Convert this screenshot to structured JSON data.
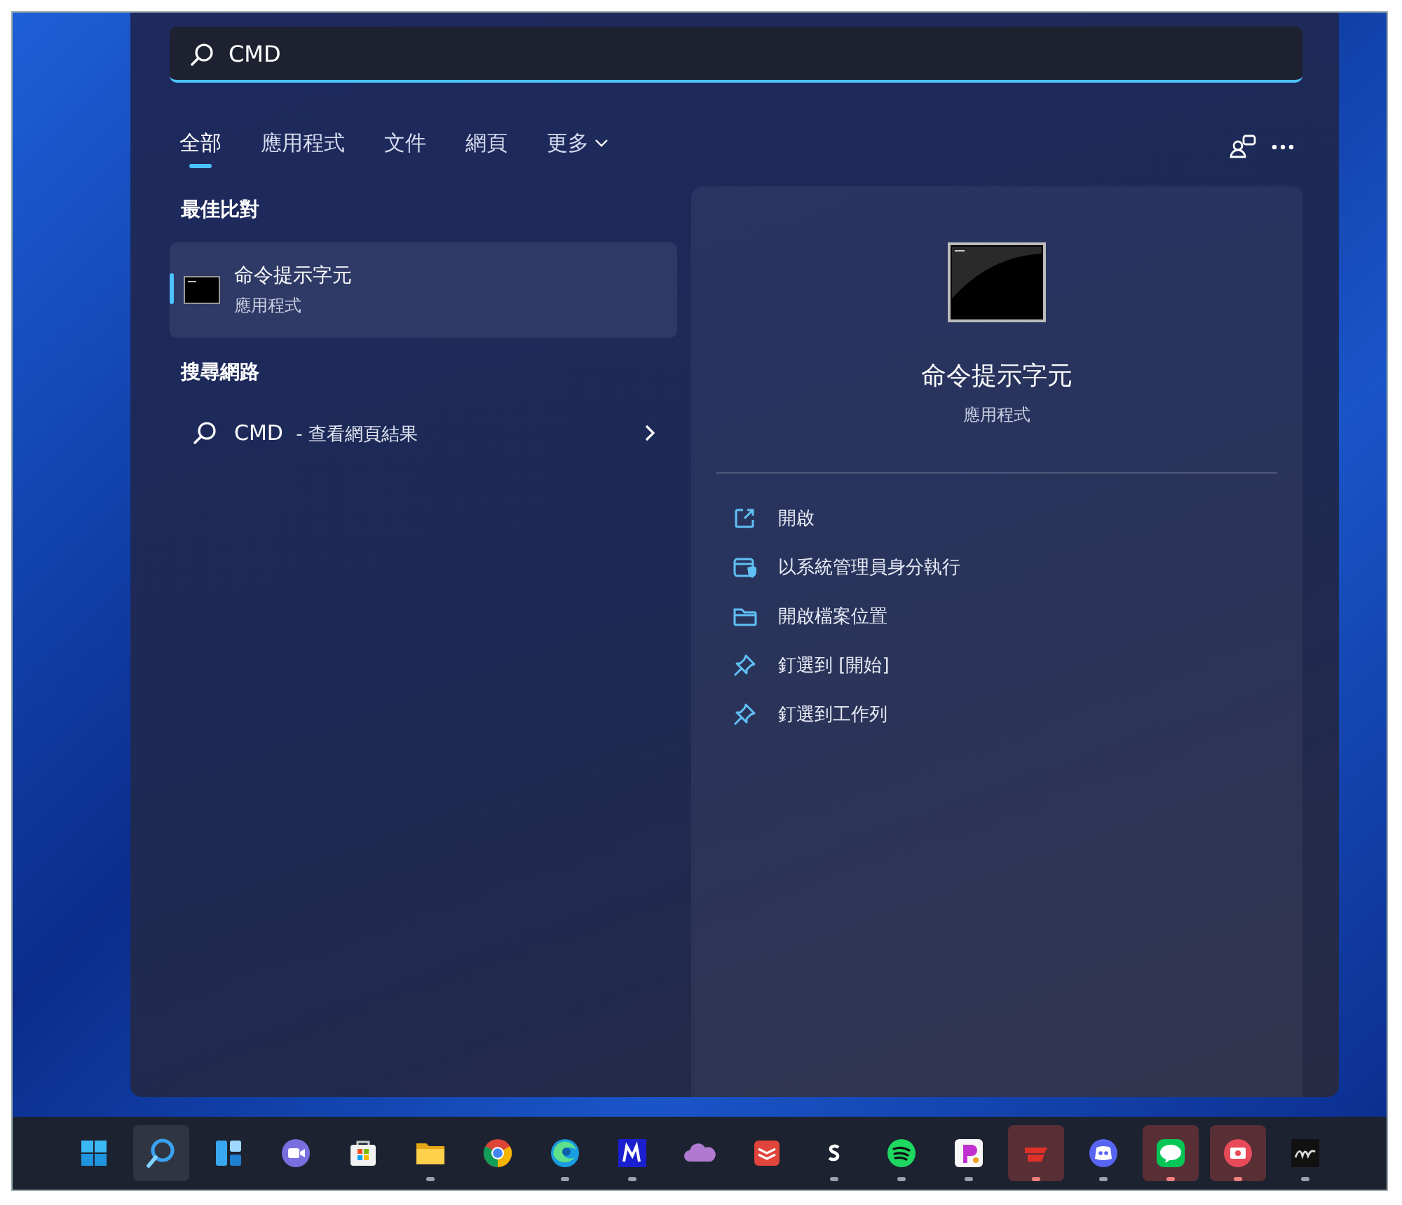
{
  "search": {
    "value": "CMD"
  },
  "tabs": [
    {
      "label": "全部",
      "selected": true,
      "kind": "plain"
    },
    {
      "label": "應用程式",
      "selected": false,
      "kind": "plain"
    },
    {
      "label": "文件",
      "selected": false,
      "kind": "plain"
    },
    {
      "label": "網頁",
      "selected": false,
      "kind": "plain"
    },
    {
      "label": "更多",
      "selected": false,
      "kind": "menu"
    }
  ],
  "best_match": {
    "heading": "最佳比對",
    "item": {
      "title": "命令提示字元",
      "subtitle": "應用程式",
      "selected": true
    }
  },
  "web_search": {
    "heading": "搜尋網路",
    "item": {
      "query": "CMD",
      "suffix": "- 查看網頁結果"
    }
  },
  "preview": {
    "title": "命令提示字元",
    "subtitle": "應用程式",
    "actions": [
      {
        "kind": "open",
        "label": "開啟"
      },
      {
        "kind": "admin",
        "label": "以系統管理員身分執行"
      },
      {
        "kind": "folder",
        "label": "開啟檔案位置"
      },
      {
        "kind": "pin",
        "label": "釘選到 [開始]"
      },
      {
        "kind": "pin",
        "label": "釘選到工作列"
      }
    ]
  },
  "taskbar": {
    "apps": [
      {
        "kind": "start",
        "selected": false,
        "running": false,
        "attention": false
      },
      {
        "kind": "search",
        "selected": true,
        "running": false,
        "attention": false
      },
      {
        "kind": "widgets",
        "selected": false,
        "running": false,
        "attention": false
      },
      {
        "kind": "chat",
        "selected": false,
        "running": false,
        "attention": false
      },
      {
        "kind": "store",
        "selected": false,
        "running": false,
        "attention": false
      },
      {
        "kind": "explorer",
        "selected": false,
        "running": true,
        "attention": false
      },
      {
        "kind": "chrome",
        "selected": false,
        "running": false,
        "attention": false
      },
      {
        "kind": "edge",
        "selected": false,
        "running": true,
        "attention": false
      },
      {
        "kind": "m",
        "selected": false,
        "running": true,
        "attention": false
      },
      {
        "kind": "cloud",
        "selected": false,
        "running": false,
        "attention": false
      },
      {
        "kind": "todo",
        "selected": false,
        "running": false,
        "attention": false
      },
      {
        "kind": "s",
        "selected": false,
        "running": true,
        "attention": false
      },
      {
        "kind": "spotify",
        "selected": false,
        "running": true,
        "attention": false
      },
      {
        "kind": "paint",
        "selected": false,
        "running": true,
        "attention": false
      },
      {
        "kind": "redapp",
        "selected": false,
        "running": true,
        "attention": true
      },
      {
        "kind": "discord",
        "selected": false,
        "running": true,
        "attention": false
      },
      {
        "kind": "line",
        "selected": false,
        "running": true,
        "attention": true
      },
      {
        "kind": "video",
        "selected": false,
        "running": true,
        "attention": true
      },
      {
        "kind": "dark",
        "selected": false,
        "running": true,
        "attention": false
      }
    ]
  }
}
